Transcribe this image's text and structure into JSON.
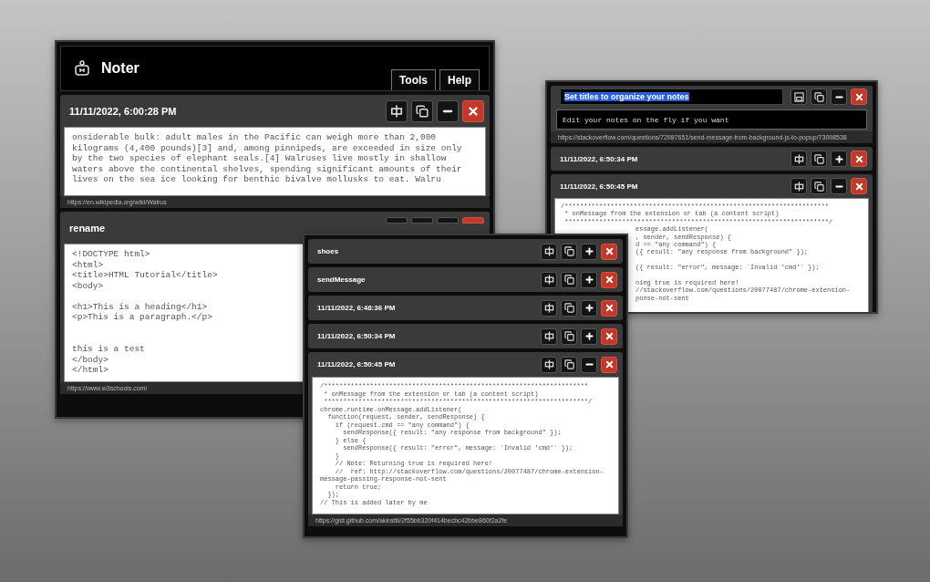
{
  "windows": [
    {
      "title": "Noter",
      "tabs": [
        {
          "label": "Tools"
        },
        {
          "label": "Help"
        }
      ],
      "notes": [
        {
          "kind": "normal",
          "title": "11/11/2022, 6:00:28 PM",
          "expanded": true,
          "body": "onsiderable bulk: adult males in the Pacific can weigh more than 2,000\nkilograms (4,400 pounds)[3] and, among pinnipeds, are exceeded in size only\nby the two species of elephant seals.[4] Walruses live mostly in shallow\nwaters above the continental shelves, spending significant amounts of their\nlives on the sea ice looking for benthic bivalve mollusks to eat. Walru",
          "url": "https://en.wikipedia.org/wiki/Walrus"
        },
        {
          "kind": "normal",
          "title": "rename",
          "expanded": true,
          "body": "<!DOCTYPE html>\n<html>\n<title>HTML Tutorial</title>\n<body>\n\n<h1>This is a heading</h1>\n<p>This is a paragraph.</p>\n\n\nthis is a test\n</body>\n</html>",
          "url": "https://www.w3schools.com/"
        }
      ]
    },
    {
      "notes": [
        {
          "kind": "normal",
          "title": "shoes",
          "expanded": false
        },
        {
          "kind": "normal",
          "title": "sendMessage",
          "expanded": false
        },
        {
          "kind": "normal",
          "title": "11/11/2022, 6:48:36 PM",
          "expanded": false
        },
        {
          "kind": "normal",
          "title": "11/11/2022, 6:50:34 PM",
          "expanded": false
        },
        {
          "kind": "normal",
          "title": "11/11/2022, 6:50:45 PM",
          "expanded": true,
          "body": "/*********************************************************************\n * onMessage from the extension or tab (a content script)\n *********************************************************************/\nchrome.runtime.onMessage.addListener(\n  function(request, sender, sendResponse) {\n    if (request.cmd == \"any command\") {\n      sendResponse({ result: \"any response from background\" });\n    } else {\n      sendResponse({ result: \"error\", message: `Invalid 'cmd'` });\n    }\n    // Note: Returning true is required here!\n    //  ref: http://stackoverflow.com/questions/20077487/chrome-extension-\nmessage-passing-response-not-sent\n    return true;\n  });\n// This is added later by me",
          "url": "https://gist.github.com/akirattii/2f55bb320f414becbc42bbe860f2a2fe"
        }
      ]
    },
    {
      "notes": [
        {
          "kind": "editing",
          "title": "Set titles to organize your notes",
          "expanded": true,
          "body": "Edit your notes on the fly if you want",
          "url": "https://stackoverflow.com/questions/72987651/send-message-from-background-js-to-popup/73098538"
        },
        {
          "kind": "normal",
          "title": "11/11/2022, 6:50:34 PM",
          "expanded": false
        },
        {
          "kind": "normal",
          "title": "11/11/2022, 6:50:45 PM",
          "expanded": true,
          "body": "/*********************************************************************\n * onMessage from the extension or tab (a content script)\n *********************************************************************/",
          "body_right_part": "essage.addListener(\n, sender, sendResponse) {\nd == \"any command\") {\n({ result: \"any response from background\" });\n\n({ result: \"error\", message: `Invalid 'cmd'` });\n\nning true is required here!\n//stackoverflow.com/questions/20077487/chrome-extension-\nponse-not-sent"
        }
      ]
    }
  ]
}
